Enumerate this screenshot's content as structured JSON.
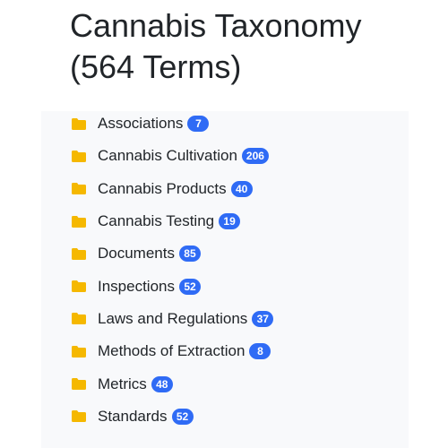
{
  "header": {
    "title_line1": "Cannabis Taxonomy",
    "title_line2": "(564 Terms)"
  },
  "colors": {
    "folder": "#f5b800",
    "badge": "#2f6bf5",
    "panel": "#f8f9fb"
  },
  "icons": {
    "folder": "folder-icon"
  },
  "categories": [
    {
      "label": "Associations",
      "count": "7"
    },
    {
      "label": "Cannabis Cultivation",
      "count": "206"
    },
    {
      "label": "Cannabis Products",
      "count": "40"
    },
    {
      "label": "Cannabis Testing",
      "count": "19"
    },
    {
      "label": "Documents",
      "count": "85"
    },
    {
      "label": "Inspections",
      "count": "52"
    },
    {
      "label": "Laws and Regulations",
      "count": "37"
    },
    {
      "label": "Methods of Extraction",
      "count": "8"
    },
    {
      "label": "Metrics",
      "count": "48"
    },
    {
      "label": "Standards",
      "count": "52"
    }
  ]
}
